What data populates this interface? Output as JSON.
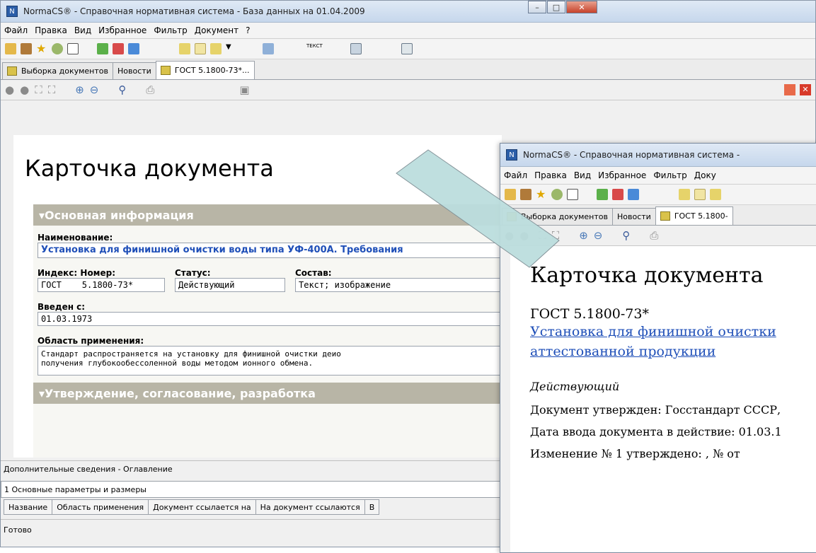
{
  "main_window": {
    "title": "NormaCS® - Справочная нормативная система - База данных на 01.04.2009",
    "menu": [
      "Файл",
      "Правка",
      "Вид",
      "Избранное",
      "Фильтр",
      "Документ",
      "?"
    ],
    "tabs": [
      "Выборка документов",
      "Новости",
      "ГОСТ 5.1800-73*..."
    ],
    "page_title": "Карточка документа",
    "section_main": "▾Основная информация",
    "label_name": "Наименование:",
    "value_name": "Установка для финишной очистки воды типа УФ-400А. Требования",
    "label_index": "Индекс: Номер:",
    "value_index": "ГОСТ    5.1800-73*",
    "label_status": "Статус:",
    "value_status": "Действующий",
    "label_composition": "Состав:",
    "value_composition": "Текст; изображение",
    "label_introduced": "Введен с:",
    "value_introduced": "01.03.1973",
    "label_scope": "Область применения:",
    "value_scope_line1": "Стандарт распространяется на установку для финишной очистки деио",
    "value_scope_line2": "получения глубокообессоленной воды методом ионного обмена.",
    "section_approval": "▾Утверждение, согласование, разработка",
    "extra_info": "Дополнительные сведения - Оглавление",
    "toc_item": "1 Основные параметры и размеры",
    "bottom_tabs": [
      "Название",
      "Область применения",
      "Документ ссылается на",
      "На документ ссылаются",
      "В"
    ],
    "status": "Готово"
  },
  "second_window": {
    "title": "NormaCS® - Справочная нормативная система -",
    "menu": [
      "Файл",
      "Правка",
      "Вид",
      "Избранное",
      "Фильтр",
      "Доку"
    ],
    "tabs": [
      "Выборка документов",
      "Новости",
      "ГОСТ 5.1800-"
    ],
    "page_title": "Карточка документа",
    "doc_code": "ГОСТ 5.1800-73*",
    "doc_link_line1": "Установка для финишной очистки",
    "doc_link_line2": "аттестованной продукции",
    "status_text": "Действующий",
    "approved_by": "Документ утвержден:  Госстандарт СССР,",
    "effective_date": "Дата ввода документа в действие:  01.03.1",
    "change": "Изменение № 1 утверждено: ,  №  от"
  },
  "colors": {
    "arrow_fill": "#bcdede",
    "arrow_stroke": "#7f8f95",
    "section_bg": "#b8b5a6",
    "link": "#1f4fb8"
  }
}
